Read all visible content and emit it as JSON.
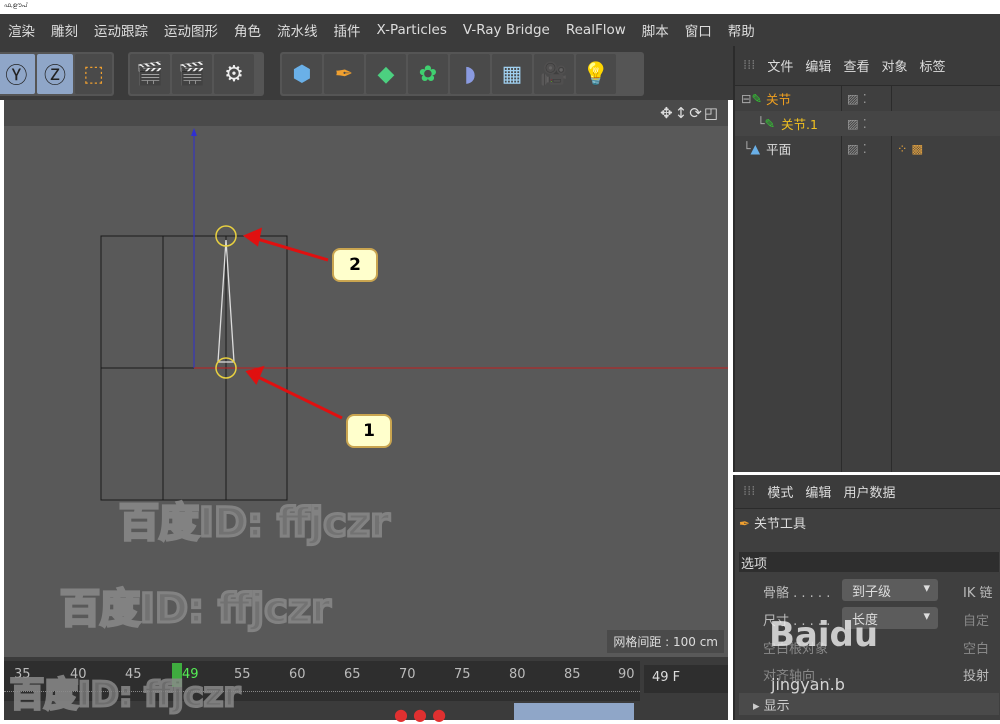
{
  "top_strip": "ഫ,ഊപ്",
  "menu": [
    "渲染",
    "雕刻",
    "运动跟踪",
    "运动图形",
    "角色",
    "流水线",
    "插件",
    "X-Particles",
    "V-Ray Bridge",
    "RealFlow",
    "脚本",
    "窗口",
    "帮助"
  ],
  "object_manager": {
    "menu": [
      "文件",
      "编辑",
      "查看",
      "对象",
      "标签"
    ],
    "objects": [
      {
        "name": "关节",
        "color": "#f0a020"
      },
      {
        "name": "关节.1",
        "color": "#f0c020"
      },
      {
        "name": "平面",
        "color": "#dddddd"
      }
    ]
  },
  "attribute_manager": {
    "menu": [
      "模式",
      "编辑",
      "用户数据"
    ],
    "tool_name": "关节工具",
    "section": "选项",
    "rows": [
      {
        "label": "骨骼 . . . . .",
        "value": "到子级"
      },
      {
        "label": "尺寸 . . . . .",
        "value": "长度"
      },
      {
        "label": "空白根对象",
        "value": ""
      },
      {
        "label": "对齐轴向 . .",
        "value": ""
      }
    ],
    "right_labels": [
      "IK 链",
      "自定",
      "空白",
      "投射"
    ],
    "collapsed_section": "显示"
  },
  "viewport": {
    "grid_spacing": "网格间距 : 100 cm",
    "callouts": [
      "2",
      "1"
    ]
  },
  "watermarks": [
    "百度ID: ffjczr",
    "Baidu",
    "jingyan.b"
  ],
  "timeline": {
    "ticks": [
      "35",
      "40",
      "45",
      "49",
      "55",
      "60",
      "65",
      "70",
      "75",
      "80",
      "85",
      "90"
    ],
    "current_frame": "49 F"
  }
}
